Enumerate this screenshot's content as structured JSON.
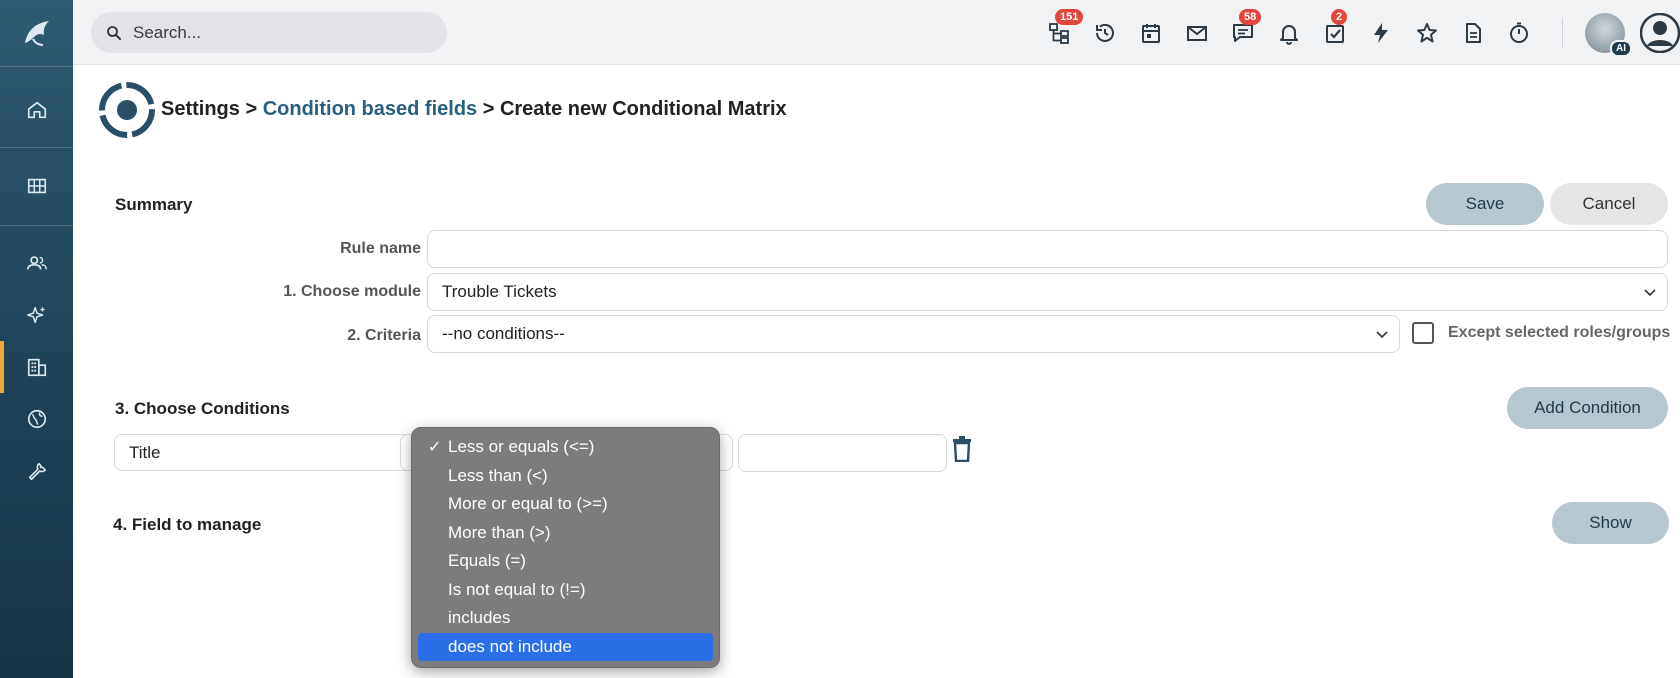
{
  "topbar": {
    "search_placeholder": "Search...",
    "badges": {
      "hierarchy": "151",
      "chat": "58",
      "tasks": "2"
    },
    "ai_label": "AI"
  },
  "header": {
    "crumb_settings": "Settings",
    "crumb_sep1": " > ",
    "crumb_link": "Condition based fields",
    "crumb_sep2": " > ",
    "crumb_current": "Create new Conditional Matrix"
  },
  "summary": {
    "title": "Summary",
    "save_label": "Save",
    "cancel_label": "Cancel",
    "rule_name_label": "Rule name",
    "rule_name_value": "",
    "module_label": "1. Choose module",
    "module_value": "Trouble Tickets",
    "criteria_label": "2. Criteria",
    "criteria_value": "--no conditions--",
    "except_label": "Except selected roles/groups"
  },
  "conditions": {
    "title": "3. Choose Conditions",
    "add_label": "Add Condition",
    "field_value": "Title",
    "value_input": ""
  },
  "field_manage": {
    "title": "4. Field to manage",
    "show_label": "Show"
  },
  "operator_dropdown": {
    "options": [
      "Less or equals (<=)",
      "Less than (<)",
      "More or equal to (>=)",
      "More than (>)",
      "Equals (=)",
      "Is not equal to (!=)",
      "includes",
      "does not include"
    ],
    "checked_index": 0,
    "highlighted_index": 7
  },
  "colors": {
    "sidebar": "#1f4257",
    "accent": "#f3a73a",
    "link": "#2a5f80",
    "button": "#b7c7cf",
    "highlight": "#2a6ee8",
    "badge": "#e2453c"
  }
}
